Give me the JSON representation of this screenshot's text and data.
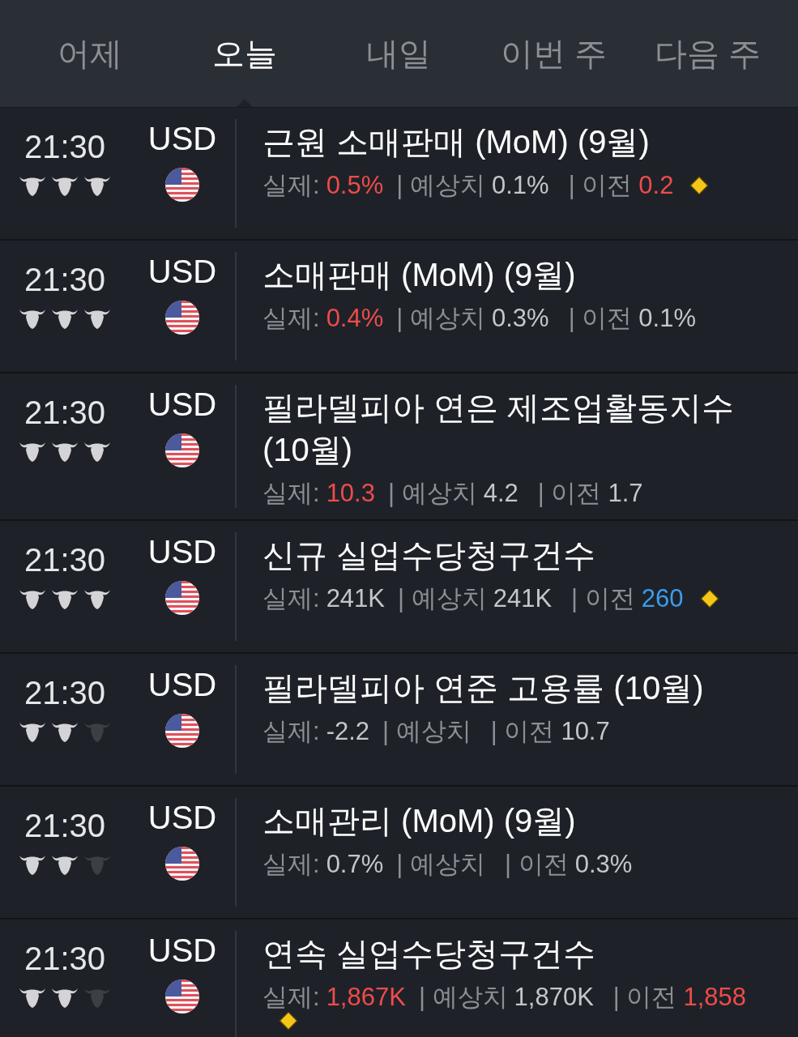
{
  "tabs": [
    {
      "label": "어제",
      "selected": false
    },
    {
      "label": "오늘",
      "selected": true
    },
    {
      "label": "내일",
      "selected": false
    },
    {
      "label": "이번 주",
      "selected": false
    },
    {
      "label": "다음 주",
      "selected": false
    }
  ],
  "events": [
    {
      "time": "21:30",
      "stars": 3,
      "currency": "USD",
      "title": "근원 소매판매 (MoM) (9월)",
      "actual_label": "실제:",
      "actual": {
        "text": "0.5%",
        "color": "#ef4b4b"
      },
      "forecast_label": "| 예상치",
      "forecast": {
        "text": "0.1%",
        "color": "#c4c6c9"
      },
      "previous_label": "| 이전",
      "previous": {
        "text": "0.2",
        "color": "#ef4b4b"
      },
      "alert": true
    },
    {
      "time": "21:30",
      "stars": 3,
      "currency": "USD",
      "title": "소매판매 (MoM) (9월)",
      "actual_label": "실제:",
      "actual": {
        "text": "0.4%",
        "color": "#ef4b4b"
      },
      "forecast_label": "| 예상치",
      "forecast": {
        "text": "0.3%",
        "color": "#c4c6c9"
      },
      "previous_label": "| 이전",
      "previous": {
        "text": "0.1%",
        "color": "#c4c6c9"
      },
      "alert": false
    },
    {
      "time": "21:30",
      "stars": 3,
      "currency": "USD",
      "title": "필라델피아 연은 제조업활동지수 (10월)",
      "actual_label": "실제:",
      "actual": {
        "text": "10.3",
        "color": "#ef4b4b"
      },
      "forecast_label": "| 예상치",
      "forecast": {
        "text": "4.2",
        "color": "#c4c6c9"
      },
      "previous_label": "| 이전",
      "previous": {
        "text": "1.7",
        "color": "#c4c6c9"
      },
      "alert": false
    },
    {
      "time": "21:30",
      "stars": 3,
      "currency": "USD",
      "title": "신규 실업수당청구건수",
      "actual_label": "실제:",
      "actual": {
        "text": "241K",
        "color": "#c4c6c9"
      },
      "forecast_label": "| 예상치",
      "forecast": {
        "text": "241K",
        "color": "#c4c6c9"
      },
      "previous_label": "| 이전",
      "previous": {
        "text": "260",
        "color": "#3b9cf0"
      },
      "alert": true
    },
    {
      "time": "21:30",
      "stars": 2,
      "currency": "USD",
      "title": "필라델피아 연준 고용률 (10월)",
      "actual_label": "실제:",
      "actual": {
        "text": "-2.2",
        "color": "#c4c6c9"
      },
      "forecast_label": "| 예상치",
      "previous_label": "| 이전",
      "previous": {
        "text": "10.7",
        "color": "#c4c6c9"
      },
      "alert": false
    },
    {
      "time": "21:30",
      "stars": 2,
      "currency": "USD",
      "title": "소매관리 (MoM) (9월)",
      "actual_label": "실제:",
      "actual": {
        "text": "0.7%",
        "color": "#c4c6c9"
      },
      "forecast_label": "| 예상치",
      "previous_label": "| 이전",
      "previous": {
        "text": "0.3%",
        "color": "#c4c6c9"
      },
      "alert": false
    },
    {
      "time": "21:30",
      "stars": 2,
      "currency": "USD",
      "title": "연속 실업수당청구건수",
      "actual_label": "실제:",
      "actual": {
        "text": "1,867K",
        "color": "#ef4b4b"
      },
      "forecast_label": "| 예상치",
      "forecast": {
        "text": "1,870K",
        "color": "#c4c6c9"
      },
      "previous_label": "| 이전",
      "previous": {
        "text": "1,858",
        "color": "#ef4b4b"
      },
      "alert": true
    }
  ]
}
